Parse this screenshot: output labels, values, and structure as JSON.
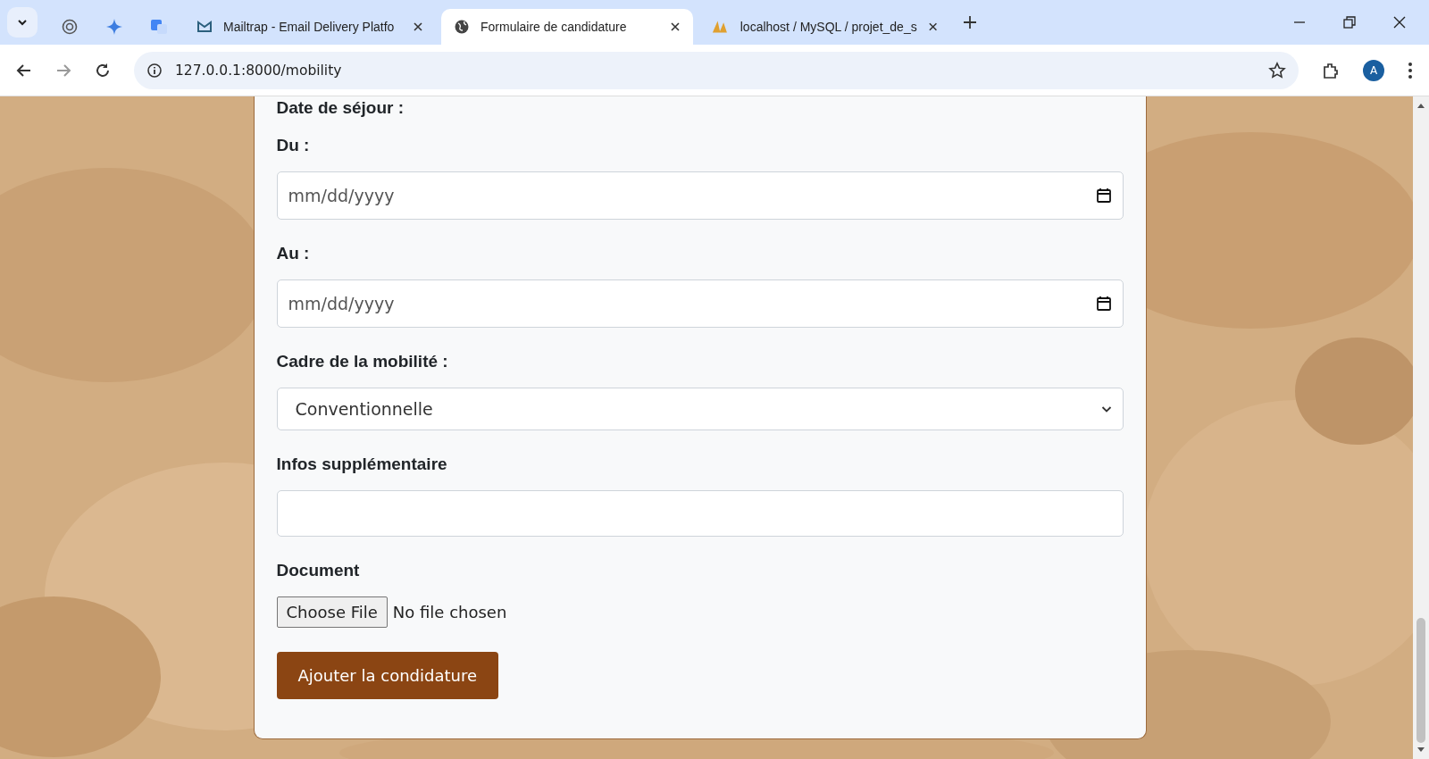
{
  "browser": {
    "tabs": [
      {
        "kind": "pinned",
        "selected": false
      },
      {
        "kind": "pinned",
        "selected": false
      },
      {
        "kind": "pinned",
        "selected": false
      },
      {
        "kind": "page",
        "title": "Mailtrap - Email Delivery Platfo",
        "selected": false
      },
      {
        "kind": "page",
        "title": "Formulaire de candidature",
        "selected": true
      },
      {
        "kind": "page",
        "title": "localhost / MySQL / projet_de_s",
        "selected": false
      }
    ],
    "address": "127.0.0.1:8000/mobility",
    "profile_initial": "A"
  },
  "form": {
    "section_title": "Date de séjour :",
    "fields": [
      {
        "kind": "date",
        "label": "Du :",
        "placeholder": "mm/dd/yyyy"
      },
      {
        "kind": "date",
        "label": "Au :",
        "placeholder": "mm/dd/yyyy"
      },
      {
        "kind": "select",
        "label": "Cadre de la mobilité :",
        "value": "Conventionnelle"
      },
      {
        "kind": "text",
        "label": "Infos supplémentaire"
      },
      {
        "kind": "file",
        "label": "Document",
        "button": "Choose File",
        "status": "No file chosen"
      }
    ],
    "submit": "Ajouter la condidature"
  }
}
